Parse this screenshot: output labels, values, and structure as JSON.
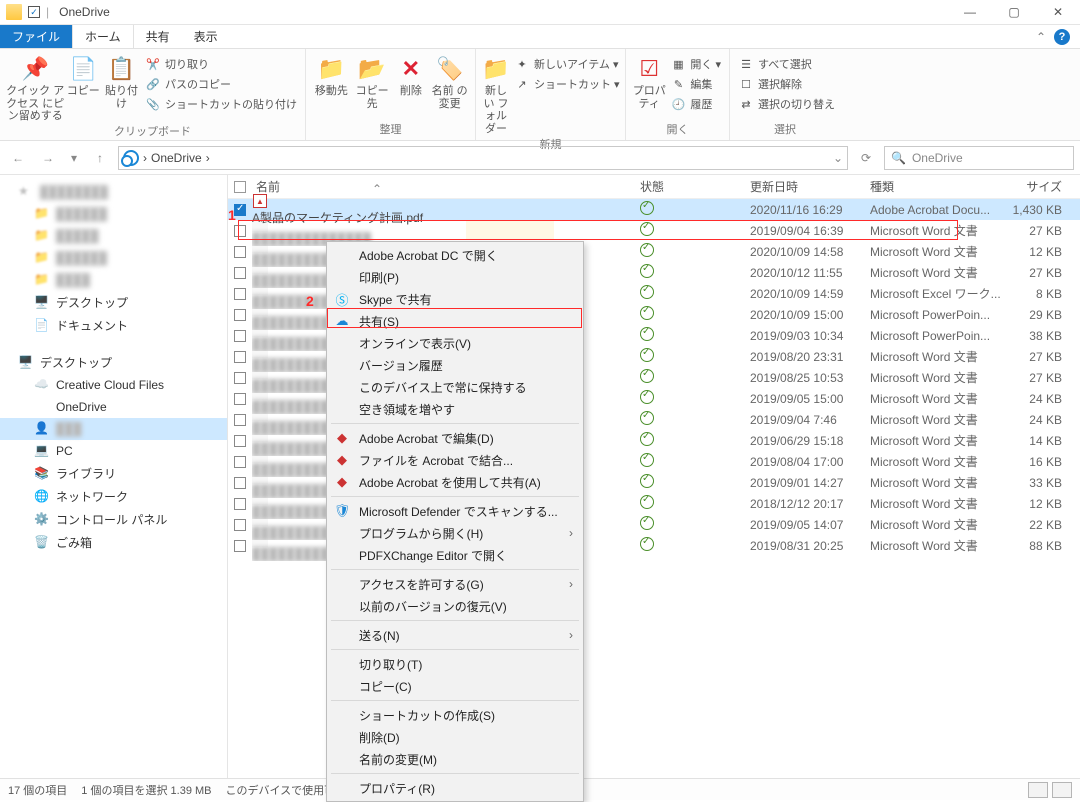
{
  "title": "OneDrive",
  "tabs": {
    "file": "ファイル",
    "home": "ホーム",
    "share": "共有",
    "view": "表示"
  },
  "ribbon": {
    "clipboard": {
      "pin": "クイック アクセス\nにピン留めする",
      "copy": "コピー",
      "paste": "貼り付け",
      "cut": "切り取り",
      "copypath": "パスのコピー",
      "pasteshortcut": "ショートカットの貼り付け",
      "group": "クリップボード"
    },
    "organize": {
      "moveto": "移動先",
      "copyto": "コピー先",
      "delete": "削除",
      "rename": "名前\nの変更",
      "group": "整理"
    },
    "new": {
      "newfolder": "新しい\nフォルダー",
      "newitem": "新しいアイテム ▾",
      "shortcut": "ショートカット ▾",
      "group": "新規"
    },
    "open": {
      "properties": "プロパティ",
      "open": "開く ▾",
      "edit": "編集",
      "history": "履歴",
      "group": "開く"
    },
    "select": {
      "selectall": "すべて選択",
      "selectnone": "選択解除",
      "invert": "選択の切り替え",
      "group": "選択"
    }
  },
  "breadcrumb": {
    "root": "OneDrive",
    "sep1": "›",
    "sep2": "›"
  },
  "search": {
    "placeholder": "OneDrive"
  },
  "columns": {
    "name": "名前",
    "status": "状態",
    "date": "更新日時",
    "type": "種類",
    "size": "サイズ"
  },
  "callouts": {
    "one": "1",
    "two": "2"
  },
  "sidebar": {
    "desktop": "デスクトップ",
    "documents": "ドキュメント",
    "desktop2": "デスクトップ",
    "ccf": "Creative Cloud Files",
    "onedrive": "OneDrive",
    "pc": "PC",
    "libraries": "ライブラリ",
    "network": "ネットワーク",
    "controlpanel": "コントロール パネル",
    "recycle": "ごみ箱"
  },
  "files": [
    {
      "name": "A製品のマーケティング計画.pdf",
      "date": "2020/11/16 16:29",
      "type": "Adobe Acrobat Docu...",
      "size": "1,430 KB",
      "selected": true,
      "icon": "pdf"
    },
    {
      "name": "",
      "date": "2019/09/04 16:39",
      "type": "Microsoft Word 文書",
      "size": "27 KB"
    },
    {
      "name": "",
      "date": "2020/10/09 14:58",
      "type": "Microsoft Word 文書",
      "size": "12 KB"
    },
    {
      "name": "",
      "date": "2020/10/12 11:55",
      "type": "Microsoft Word 文書",
      "size": "27 KB"
    },
    {
      "name": "",
      "date": "2020/10/09 14:59",
      "type": "Microsoft Excel ワーク...",
      "size": "8 KB"
    },
    {
      "name": "",
      "date": "2020/10/09 15:00",
      "type": "Microsoft PowerPoin...",
      "size": "29 KB"
    },
    {
      "name": "",
      "date": "2019/09/03 10:34",
      "type": "Microsoft PowerPoin...",
      "size": "38 KB"
    },
    {
      "name": "",
      "date": "2019/08/20 23:31",
      "type": "Microsoft Word 文書",
      "size": "27 KB"
    },
    {
      "name": "",
      "date": "2019/08/25 10:53",
      "type": "Microsoft Word 文書",
      "size": "27 KB"
    },
    {
      "name": "",
      "date": "2019/09/05 15:00",
      "type": "Microsoft Word 文書",
      "size": "24 KB"
    },
    {
      "name": "",
      "date": "2019/09/04 7:46",
      "type": "Microsoft Word 文書",
      "size": "24 KB"
    },
    {
      "name": "",
      "date": "2019/06/29 15:18",
      "type": "Microsoft Word 文書",
      "size": "14 KB"
    },
    {
      "name": "",
      "date": "2019/08/04 17:00",
      "type": "Microsoft Word 文書",
      "size": "16 KB"
    },
    {
      "name": "",
      "date": "2019/09/01 14:27",
      "type": "Microsoft Word 文書",
      "size": "33 KB"
    },
    {
      "name": "",
      "date": "2018/12/12 20:17",
      "type": "Microsoft Word 文書",
      "size": "12 KB"
    },
    {
      "name": "",
      "date": "2019/09/05 14:07",
      "type": "Microsoft Word 文書",
      "size": "22 KB"
    },
    {
      "name": "",
      "date": "2019/08/31 20:25",
      "type": "Microsoft Word 文書",
      "size": "88 KB"
    }
  ],
  "context": {
    "open_acrobat": "Adobe Acrobat DC で開く",
    "print": "印刷(P)",
    "skype": "Skype で共有",
    "share": "共有(S)",
    "view_online": "オンラインで表示(V)",
    "version_history": "バージョン履歴",
    "always_keep": "このデバイス上で常に保持する",
    "free_space": "空き領域を増やす",
    "edit_acrobat": "Adobe Acrobat で編集(D)",
    "combine_acrobat": "ファイルを Acrobat で結合...",
    "share_acrobat": "Adobe Acrobat を使用して共有(A)",
    "defender": "Microsoft Defender でスキャンする...",
    "open_with": "プログラムから開く(H)",
    "pdfxchange": "PDFXChange Editor で開く",
    "grant_access": "アクセスを許可する(G)",
    "restore_versions": "以前のバージョンの復元(V)",
    "send_to": "送る(N)",
    "cut": "切り取り(T)",
    "copy": "コピー(C)",
    "create_shortcut": "ショートカットの作成(S)",
    "delete": "削除(D)",
    "rename": "名前の変更(M)",
    "properties": "プロパティ(R)"
  },
  "statusbar": {
    "count": "17 個の項目",
    "selected": "1 個の項目を選択 1.39 MB",
    "device": "このデバイスで使用可能"
  }
}
